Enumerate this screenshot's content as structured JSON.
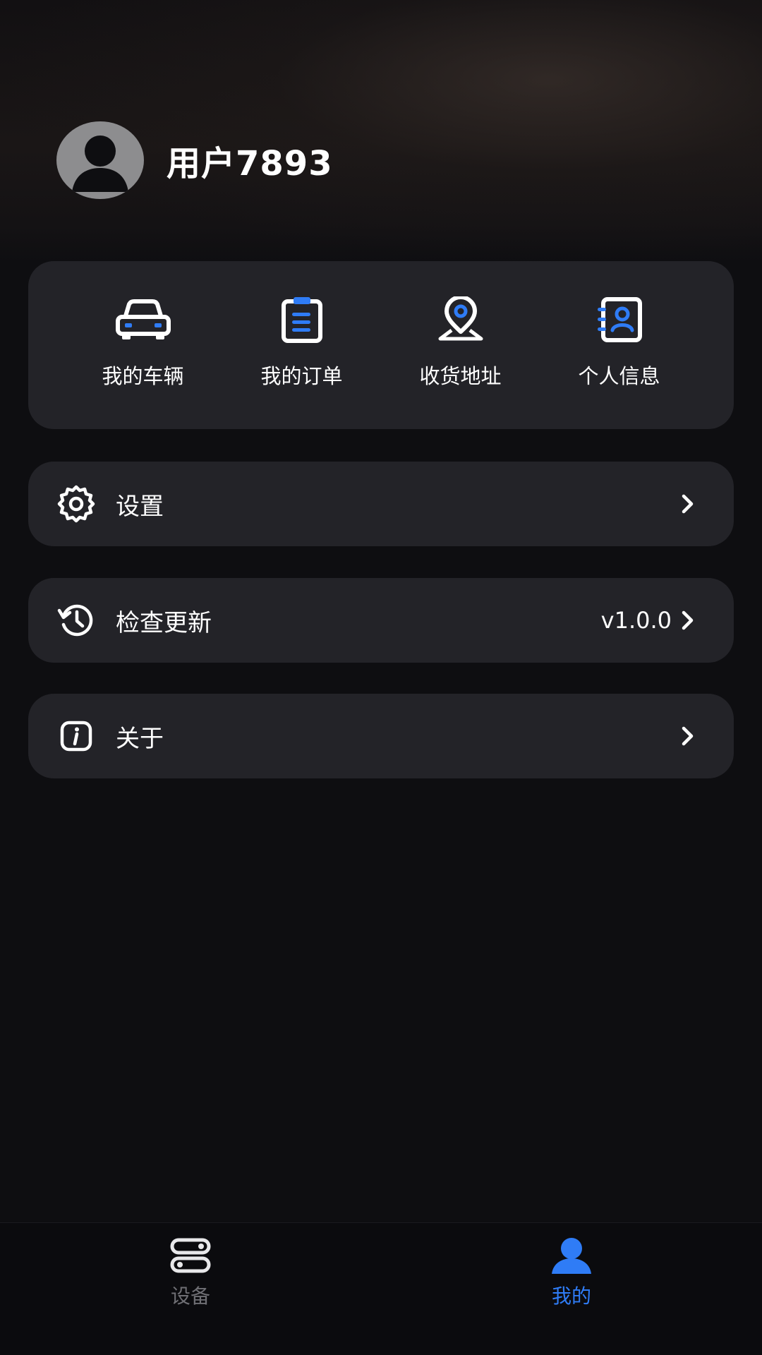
{
  "profile": {
    "username": "用户7893"
  },
  "quick_actions": [
    {
      "label": "我的车辆",
      "icon": "car-icon"
    },
    {
      "label": "我的订单",
      "icon": "clipboard-icon"
    },
    {
      "label": "收货地址",
      "icon": "location-pin-icon"
    },
    {
      "label": "个人信息",
      "icon": "contact-card-icon"
    }
  ],
  "menu": {
    "settings": {
      "label": "设置",
      "icon": "gear-icon"
    },
    "update": {
      "label": "检查更新",
      "value": "v1.0.0",
      "icon": "history-icon"
    },
    "about": {
      "label": "关于",
      "icon": "info-icon"
    }
  },
  "bottom_nav": {
    "devices": {
      "label": "设备",
      "icon": "device-toggle-icon"
    },
    "mine": {
      "label": "我的",
      "icon": "person-icon"
    }
  },
  "colors": {
    "accent": "#2f7cf6",
    "card": "#232328",
    "background": "#0e0e11"
  }
}
